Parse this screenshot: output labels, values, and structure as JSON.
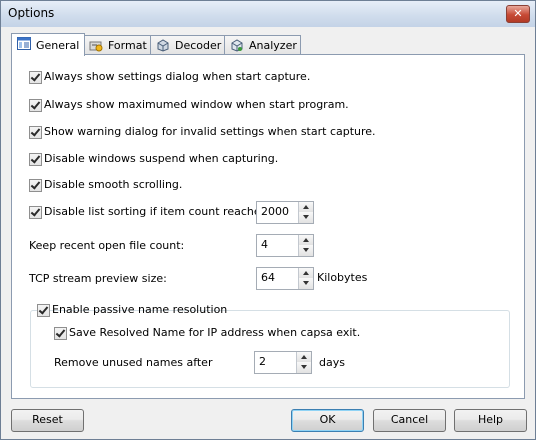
{
  "window": {
    "title": "Options",
    "close_symbol": "✕"
  },
  "tabs": [
    {
      "label": "General",
      "icon": "general-settings-icon",
      "active": true
    },
    {
      "label": "Format",
      "icon": "format-icon",
      "active": false
    },
    {
      "label": "Decoder",
      "icon": "decoder-icon",
      "active": false
    },
    {
      "label": "Analyzer",
      "icon": "analyzer-icon",
      "active": false
    }
  ],
  "general": {
    "options": [
      {
        "label": "Always show settings dialog when start capture.",
        "checked": true
      },
      {
        "label": "Always show maximumed window when start program.",
        "checked": true
      },
      {
        "label": "Show warning dialog for invalid settings when start capture.",
        "checked": true
      },
      {
        "label": "Disable windows suspend when capturing.",
        "checked": true
      },
      {
        "label": "Disable smooth scrolling.",
        "checked": true
      }
    ],
    "list_sorting": {
      "label": "Disable list sorting if item count reaches:",
      "checked": true,
      "value": "2000"
    },
    "recent_files": {
      "label": "Keep recent open file count:",
      "value": "4"
    },
    "tcp_preview": {
      "label": "TCP stream preview size:",
      "value": "64",
      "unit": "Kilobytes"
    },
    "name_resolution": {
      "label": "Enable passive name resolution",
      "checked": true,
      "save_resolved": {
        "label": "Save Resolved Name for IP address when capsa exit.",
        "checked": true
      },
      "remove_unused": {
        "label": "Remove unused names after",
        "value": "2",
        "unit": "days"
      }
    }
  },
  "buttons": {
    "reset": "Reset",
    "ok": "OK",
    "cancel": "Cancel",
    "help": "Help"
  }
}
